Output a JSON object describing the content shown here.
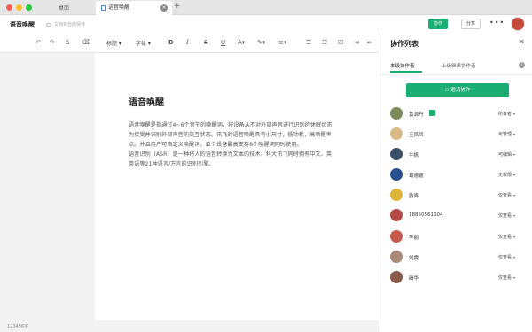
{
  "tabs": {
    "inactive": "桌面",
    "active": "语音唤醒"
  },
  "header": {
    "title": "语音唤醒",
    "save_status": "文档将自动保存",
    "collab_label": "协作",
    "share_label": "分享"
  },
  "toolbar": {
    "heading_label": "标题",
    "font_label": "字体"
  },
  "document": {
    "title": "语音唤醒",
    "paragraphs": [
      "语音唤醒是指通过4~6个音节的唤醒词，将设备从不对外部声音进行识别的休眠状态",
      "为接受并识别外部声音的交互状态。讯飞的语音唤醒具有小尺寸，低功耗，高唤醒率",
      "点。并且用户可自定义唤醒词，单个设备最高支持8个唤醒词同时使用。",
      "语音识别（ASR）是一种将人的语音转换为文本的技术。科大讯飞同时拥有中文、英",
      "英语等21种语言/方言的识别引擎。"
    ]
  },
  "status": {
    "word_count": "123456字"
  },
  "panel": {
    "title": "协作列表",
    "tab_members": "本级协作者",
    "tab_parent": "上级继承协作者",
    "invite_label": "邀请协作",
    "members": [
      {
        "name": "黄源丹",
        "permission": "所有者",
        "avatar_color": "#7a8a5a",
        "badge": true
      },
      {
        "name": "王凤凤",
        "permission": "可管理",
        "avatar_color": "#d9b98a",
        "badge": false
      },
      {
        "name": "牛帆",
        "permission": "可编辑",
        "avatar_color": "#3b5068",
        "badge": false
      },
      {
        "name": "葛德德",
        "permission": "无权限",
        "avatar_color": "#2a4f8f",
        "badge": false
      },
      {
        "name": "韵弄",
        "permission": "仅查看",
        "avatar_color": "#e0b33a",
        "badge": false
      },
      {
        "name": "18850561604",
        "permission": "仅查看",
        "avatar_color": "#b44b46",
        "badge": false
      },
      {
        "name": "华丽",
        "permission": "仅查看",
        "avatar_color": "#c7584c",
        "badge": false
      },
      {
        "name": "刘雯",
        "permission": "仅查看",
        "avatar_color": "#a98a7a",
        "badge": false
      },
      {
        "name": "碣华",
        "permission": "仅查看",
        "avatar_color": "#8a5a4a",
        "badge": false
      }
    ]
  },
  "colors": {
    "accent": "#1aad74",
    "close_dot": "#fe5f57",
    "min_dot": "#febc2e",
    "max_dot": "#28c840"
  }
}
